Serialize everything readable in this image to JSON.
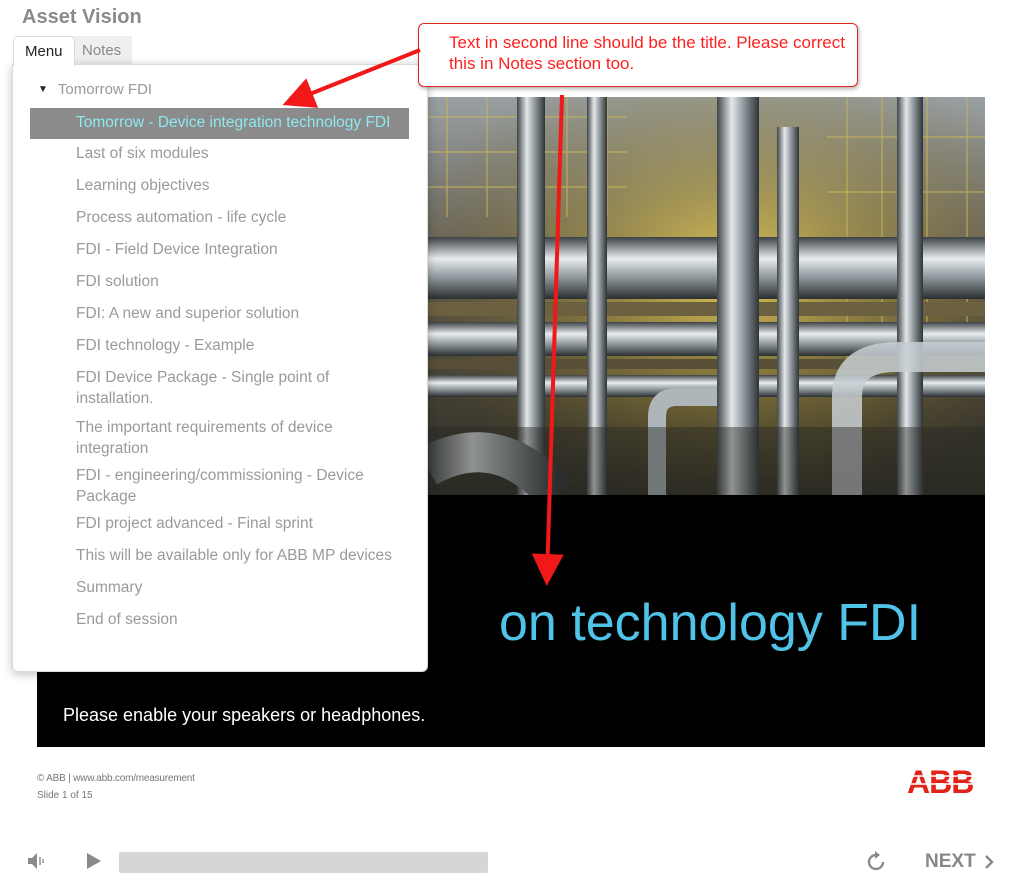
{
  "app": {
    "title": "Asset Vision"
  },
  "tabs": {
    "menu": "Menu",
    "notes": "Notes"
  },
  "menu": {
    "root": "Tomorrow FDI",
    "items": [
      "Tomorrow - Device integration technology FDI",
      "Last of six modules",
      "Learning objectives",
      "Process automation - life cycle",
      "FDI - Field Device Integration",
      "FDI solution",
      "FDI: A new and superior solution",
      "FDI technology - Example",
      "FDI Device Package - Single point of installation.",
      "The important requirements of device integration",
      "FDI - engineering/commissioning - Device Package",
      "FDI project advanced - Final sprint",
      "This will be available only for ABB MP devices",
      "Summary",
      "End of session"
    ]
  },
  "slide": {
    "title_visible": "on technology FDI",
    "subtitle": "Please enable your speakers or headphones."
  },
  "footer": {
    "copyright": "© ABB | www.abb.com/measurement",
    "slide_counter": "Slide 1 of 15",
    "logo": "ABB"
  },
  "annotation": {
    "text": "Text in second line should be the title. Please correct this in Notes section too."
  },
  "player": {
    "next_label": "NEXT"
  },
  "colors": {
    "accent_cyan": "#4fc3e8",
    "annotation_red": "#e0271f",
    "abb_red": "#e2231a"
  }
}
